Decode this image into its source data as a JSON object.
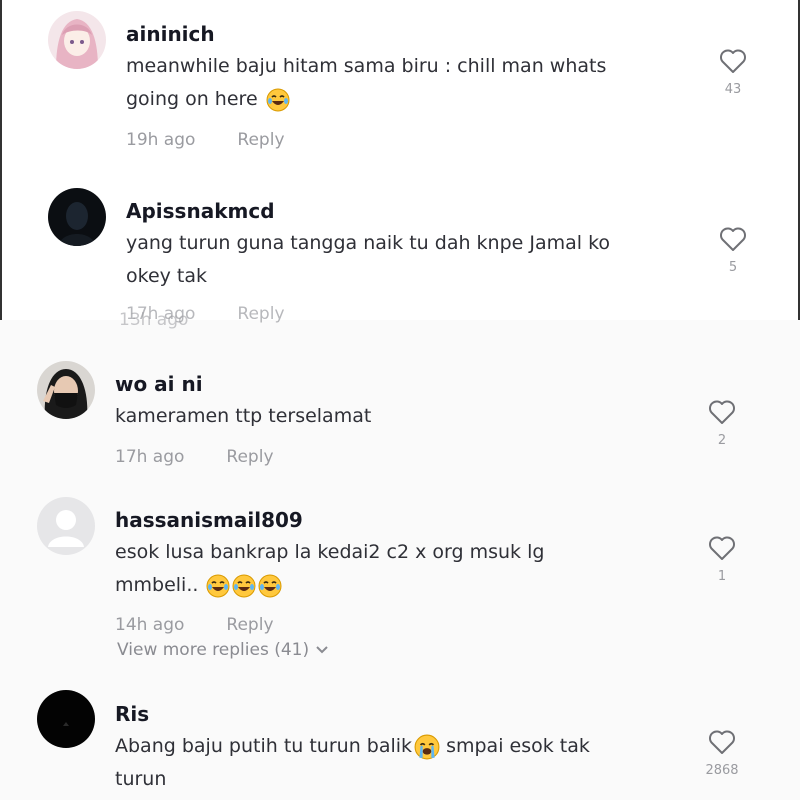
{
  "colors": {
    "like_icon": "#6f7075",
    "muted": "#9a9ba0",
    "bg": "#fafafa"
  },
  "comments": [
    {
      "username": "aininich",
      "text_lines": [
        "meanwhile baju hitam sama biru : chill man whats",
        "going on here"
      ],
      "emoji": "laughing-tears",
      "time": "19h ago",
      "reply": "Reply",
      "likes": "43"
    },
    {
      "username": "Apissnakmcd",
      "text_lines": [
        "yang turun guna tangga naik tu dah knpe Jamal ko",
        "okey tak"
      ],
      "time": "17h ago",
      "reply": "Reply",
      "ghost_time": "13h ago",
      "likes": "5"
    },
    {
      "username": "wo ai ni",
      "text_lines": [
        "kameramen ttp terselamat"
      ],
      "time": "17h ago",
      "reply": "Reply",
      "likes": "2"
    },
    {
      "username": "hassanismail809",
      "text_lines": [
        "esok lusa bankrap la kedai2 c2 x org msuk lg",
        "mmbeli.."
      ],
      "emoji": "laughing-tears x3",
      "time": "14h ago",
      "reply": "Reply",
      "view_more": "View more replies (41)",
      "likes": "1"
    },
    {
      "username": "Ris",
      "text_lines": [
        "Abang baju putih tu turun balik",
        "smpai esok tak",
        "turun"
      ],
      "emoji": "crying-face",
      "likes": "2868"
    }
  ]
}
